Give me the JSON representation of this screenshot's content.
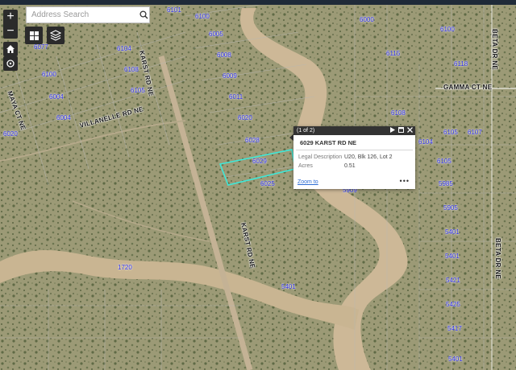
{
  "search": {
    "placeholder": "Address Search"
  },
  "zoom": {
    "in": "+",
    "out": "−"
  },
  "popup": {
    "counter": "(1 of 2)",
    "title": "6029 KARST RD NE",
    "fields": [
      {
        "key": "Legal Description",
        "value": "U20, Blk 126, Lot 2"
      },
      {
        "key": "Acres",
        "value": "0.51"
      }
    ],
    "zoom_link": "Zoom to",
    "more": "•••"
  },
  "roads": {
    "karst_upper": "KARST RD NE",
    "karst_lower": "KARST RD NE",
    "villanelle": "VILLANELLE RD NE",
    "maya": "MAYA CT NE",
    "gamma": "GAMMA CT NE",
    "beta_upper": "BETA DR NE",
    "beta_lower": "BETA DR NE"
  },
  "parcels": [
    "6101",
    "6100",
    "6005",
    "6008",
    "6104",
    "6009",
    "6108",
    "6100",
    "6004",
    "6105",
    "6011",
    "6004",
    "6077",
    "6020",
    "6020",
    "6028",
    "6021",
    "6029",
    "6025",
    "6000",
    "5705",
    "6100",
    "6115",
    "6118",
    "6108",
    "6105",
    "6107",
    "6104",
    "6105",
    "5985",
    "5909",
    "5905",
    "5401",
    "5401",
    "5421",
    "5425",
    "5417",
    "5401",
    "5401",
    "5425",
    "1720"
  ],
  "colors": {
    "parcel_label": "#2a2ae0",
    "selection": "#3fe8d8"
  }
}
